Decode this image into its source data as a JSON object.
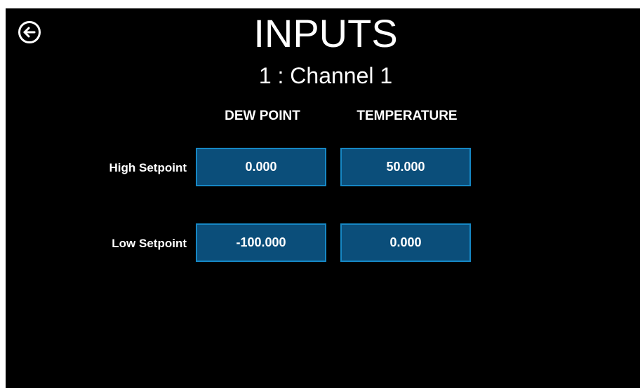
{
  "header": {
    "title": "INPUTS",
    "subtitle": "1 : Channel 1",
    "back_icon": "back-arrow-circle-icon"
  },
  "columns": {
    "dew_point": "DEW POINT",
    "temperature": "TEMPERATURE"
  },
  "rows": {
    "high": {
      "label": "High Setpoint",
      "dew_point": "0.000",
      "temperature": "50.000"
    },
    "low": {
      "label": "Low Setpoint",
      "dew_point": "-100.000",
      "temperature": "0.000"
    }
  },
  "colors": {
    "background": "#000000",
    "field_fill": "#0b4e7a",
    "field_border": "#1687c4",
    "text": "#ffffff"
  }
}
